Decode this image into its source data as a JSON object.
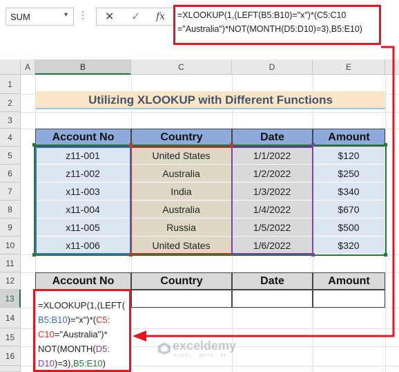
{
  "formula_bar": {
    "name_box": "SUM",
    "cancel_icon": "✕",
    "enter_icon": "✓",
    "fx_label": "fx",
    "formula_line1": "=XLOOKUP(1,(LEFT(B5:B10)=\"x\")*(C5:C10",
    "formula_line2": "=\"Australia\")*NOT(MONTH(D5:D10)=3),B5:E10)"
  },
  "columns": [
    "A",
    "B",
    "C",
    "D",
    "E"
  ],
  "rows": [
    "1",
    "2",
    "3",
    "4",
    "5",
    "6",
    "7",
    "8",
    "9",
    "10",
    "11",
    "12",
    "13",
    "14",
    "15",
    "16"
  ],
  "title": "Utilizing XLOOKUP with Different Functions",
  "table": {
    "headers": [
      "Account No",
      "Country",
      "Date",
      "Amount"
    ],
    "rows": [
      [
        "z11-001",
        "United States",
        "1/1/2022",
        "$120"
      ],
      [
        "z11-002",
        "Australia",
        "1/2/2022",
        "$250"
      ],
      [
        "x11-003",
        "India",
        "1/3/2022",
        "$340"
      ],
      [
        "x11-004",
        "Australia",
        "1/4/2022",
        "$670"
      ],
      [
        "x11-005",
        "Russia",
        "1/5/2022",
        "$500"
      ],
      [
        "x11-006",
        "United States",
        "1/6/2022",
        "$320"
      ]
    ]
  },
  "output": {
    "headers": [
      "Account No",
      "Country",
      "Date",
      "Amount"
    ]
  },
  "editor": {
    "t1": "=XLOOKUP(1,(LEFT(",
    "r1": "B5:B10",
    "t2": ")=\"x\")*(",
    "r2": "C5:",
    "r2b": "C10",
    "t3": "=\"Australia\")*",
    "t4": "NOT(MONTH(",
    "r3": "D5:",
    "r3b": "D10",
    "t5": ")=3),",
    "r4": "B5:E10",
    "t6": ")"
  },
  "watermark": {
    "brand": "exceldemy",
    "tagline": "EXCEL · DATA · BI"
  },
  "colors": {
    "ref_b": "#3b6fc4",
    "ref_c": "#c0392b",
    "ref_d": "#7a3fb0",
    "ref_e": "#227a35",
    "highlight": "#e8141d"
  }
}
